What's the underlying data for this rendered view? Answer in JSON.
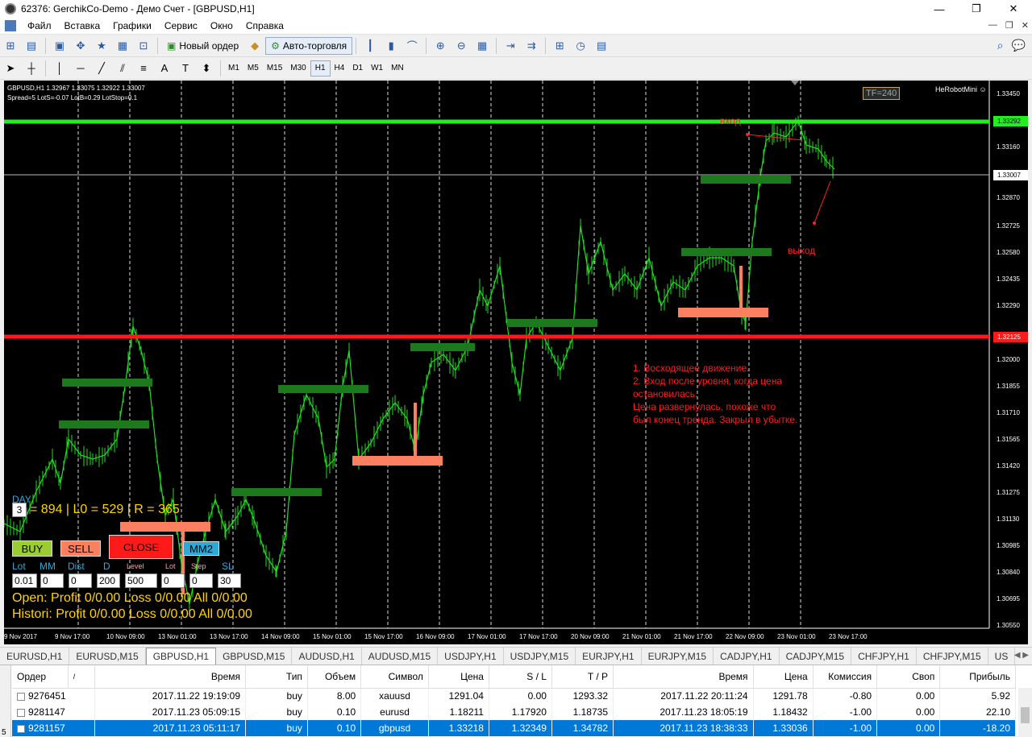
{
  "window": {
    "title": "62376: GerchikCo-Demo - Демо Счет - [GBPUSD,H1]"
  },
  "menu": [
    "Файл",
    "Вставка",
    "Графики",
    "Сервис",
    "Окно",
    "Справка"
  ],
  "toolbar": {
    "new_order": "Новый ордер",
    "auto_trading": "Авто-торговля"
  },
  "timeframes": [
    "M1",
    "M5",
    "M15",
    "M30",
    "H1",
    "H4",
    "D1",
    "W1",
    "MN"
  ],
  "timeframe_selected": "H1",
  "chart": {
    "info_line1": "GBPUSD,H1  1.32967 1.33075 1.32922 1.33007",
    "info_line2": "Spread=5  LotS=-0.07  LotB=0.29  LotStop=0.1",
    "tf_badge": "TF=240",
    "robot": "HeRobotMini ☺",
    "label_entry": "вход",
    "label_exit": "выход",
    "note": [
      "1. Восходящее движение.",
      "2. Вход после уровня, когда цена",
      "остановилась.",
      "Цена развернулась, похоже что",
      "был конец тренда. Закрыл в убытке."
    ],
    "price_ticks": [
      "1.33450",
      "1.33160",
      "1.32870",
      "1.32725",
      "1.32580",
      "1.32435",
      "1.32290",
      "1.32000",
      "1.31855",
      "1.31710",
      "1.31565",
      "1.31420",
      "1.31275",
      "1.31130",
      "1.30985",
      "1.30840",
      "1.30695",
      "1.30550"
    ],
    "green_level": "1.33292",
    "current_price": "1.33007",
    "red_level": "1.32125",
    "time_ticks": [
      "9 Nov 2017",
      "9 Nov 17:00",
      "10 Nov 09:00",
      "13 Nov 01:00",
      "13 Nov 17:00",
      "14 Nov 09:00",
      "15 Nov 01:00",
      "15 Nov 17:00",
      "16 Nov 09:00",
      "17 Nov 01:00",
      "17 Nov 17:00",
      "20 Nov 09:00",
      "21 Nov 01:00",
      "21 Nov 17:00",
      "22 Nov 09:00",
      "23 Nov 01:00",
      "23 Nov 17:00"
    ],
    "colors": {
      "green_level": "#22ee22",
      "red_level": "#ff1a1a",
      "candle": "#22dd22"
    }
  },
  "panel": {
    "day_label": "DAY",
    "day_value": "3",
    "stats": "= 894  | L0 = 529 | R = 365",
    "buy": "BUY",
    "sell": "SELL",
    "close": "CLOSE",
    "mm2": "MM2",
    "labels": [
      "Lot",
      "MM",
      "Dist",
      "D",
      "Level",
      "Lot",
      "Step",
      "SL"
    ],
    "inputs": [
      "0.01",
      "0",
      "0",
      "200",
      "500",
      "0",
      "0",
      "30"
    ],
    "open_line": "Open:  Profit 0/0.00  Loss 0/0.00  All 0/0.00",
    "history_line": "Histori: Profit 0/0.00  Loss 0/0.00  All 0/0.00"
  },
  "tabs": [
    "EURUSD,H1",
    "EURUSD,M15",
    "GBPUSD,H1",
    "GBPUSD,M15",
    "AUDUSD,H1",
    "AUDUSD,M15",
    "USDJPY,H1",
    "USDJPY,M15",
    "EURJPY,H1",
    "EURJPY,M15",
    "CADJPY,H1",
    "CADJPY,M15",
    "CHFJPY,H1",
    "CHFJPY,M15",
    "US"
  ],
  "tab_selected": "GBPUSD,H1",
  "orders": {
    "headers": [
      "Ордер",
      "/",
      "Время",
      "Тип",
      "Объем",
      "Символ",
      "Цена",
      "S / L",
      "T / P",
      "Время",
      "Цена",
      "Комиссия",
      "Своп",
      "Прибыль"
    ],
    "rows": [
      [
        "9276451",
        "2017.11.22 19:19:09",
        "buy",
        "8.00",
        "xauusd",
        "1291.04",
        "0.00",
        "1293.32",
        "2017.11.22 20:11:24",
        "1291.78",
        "-0.80",
        "0.00",
        "5.92"
      ],
      [
        "9281147",
        "2017.11.23 05:09:15",
        "buy",
        "0.10",
        "eurusd",
        "1.18211",
        "1.17920",
        "1.18735",
        "2017.11.23 18:05:19",
        "1.18432",
        "-1.00",
        "0.00",
        "22.10"
      ],
      [
        "9281157",
        "2017.11.23 05:11:17",
        "buy",
        "0.10",
        "gbpusd",
        "1.33218",
        "1.32349",
        "1.34782",
        "2017.11.23 18:38:33",
        "1.33036",
        "-1.00",
        "0.00",
        "-18.20"
      ]
    ],
    "selected_row": 2
  },
  "terminal_side": "5"
}
